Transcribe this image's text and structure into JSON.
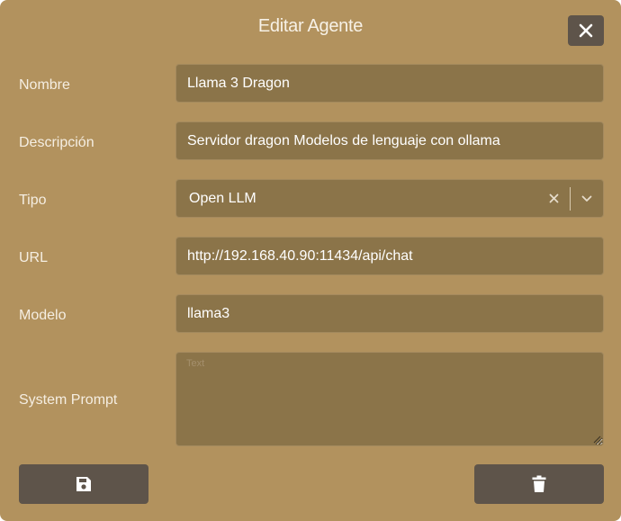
{
  "dialog": {
    "title": "Editar Agente",
    "close_icon": "close-icon"
  },
  "fields": {
    "nombre": {
      "label": "Nombre",
      "value": "Llama 3 Dragon"
    },
    "descripcion": {
      "label": "Descripción",
      "value": "Servidor dragon Modelos de lenguaje con ollama"
    },
    "tipo": {
      "label": "Tipo",
      "value": "Open LLM",
      "clear_icon": "clear-icon",
      "dropdown_icon": "chevron-down-icon"
    },
    "url": {
      "label": "URL",
      "value": "http://192.168.40.90:11434/api/chat"
    },
    "modelo": {
      "label": "Modelo",
      "value": "llama3"
    },
    "system_prompt": {
      "label": "System Prompt",
      "value": "",
      "placeholder": "Text"
    }
  },
  "actions": {
    "save_icon": "floppy-disk-icon",
    "delete_icon": "trash-icon"
  },
  "colors": {
    "dialog_bg": "#b2925e",
    "input_bg": "#8b7449",
    "button_bg": "#5e544a",
    "text": "#ffffff"
  }
}
